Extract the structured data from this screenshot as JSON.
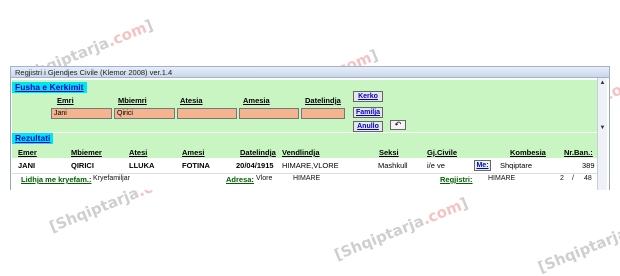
{
  "watermark": {
    "brand": "Shqiptarja",
    "domain": ".com"
  },
  "window": {
    "title": "Regjistri i Gjendjes Civile (Klemor 2008) ver.1.4"
  },
  "search": {
    "header": "Fusha e Kerkimit",
    "fields": [
      {
        "label": "Emri",
        "value": "Jani"
      },
      {
        "label": "Mbiemri",
        "value": "Qirici"
      },
      {
        "label": "Atesia",
        "value": ""
      },
      {
        "label": "Amesia",
        "value": ""
      },
      {
        "label": "Datelindja",
        "value": ""
      }
    ],
    "buttons": {
      "search": "Kerko",
      "family": "Familja",
      "cancel": "Anullo"
    },
    "undo_icon": "undo-arrow-icon"
  },
  "results": {
    "header": "Rezultati",
    "columns": [
      "Emer",
      "Mbiemer",
      "Atesi",
      "Amesi",
      "Datelindja",
      "Vendlindja",
      "Seksi",
      "Gj.Civile",
      "Kombesia",
      "Nr.Ban.:"
    ],
    "row": {
      "emer": "JANI",
      "mbiemer": "QIRICI",
      "atesi": "LLUKA",
      "amesi": "FOTINA",
      "datelindja": "20/04/1915",
      "vendlindja": "HIMARE,VLORE",
      "seksi": "Mashkull",
      "gj_civile": "i/e ve",
      "me_label": "Me:",
      "kombesia": "Shqiptare",
      "nr_ban": "389"
    },
    "detail": {
      "lidhja_label": "Lidhja me kryefam.:",
      "lidhja_value": "Kryefamiljar",
      "adresa_label": "Adresa:",
      "adresa_city": "Vlore",
      "adresa_place": "HIMARE",
      "regjistri_label": "Regjistri:",
      "regjistri_value": "HIMARE",
      "page_current": "2",
      "page_sep": "/",
      "page_total": "48"
    }
  }
}
